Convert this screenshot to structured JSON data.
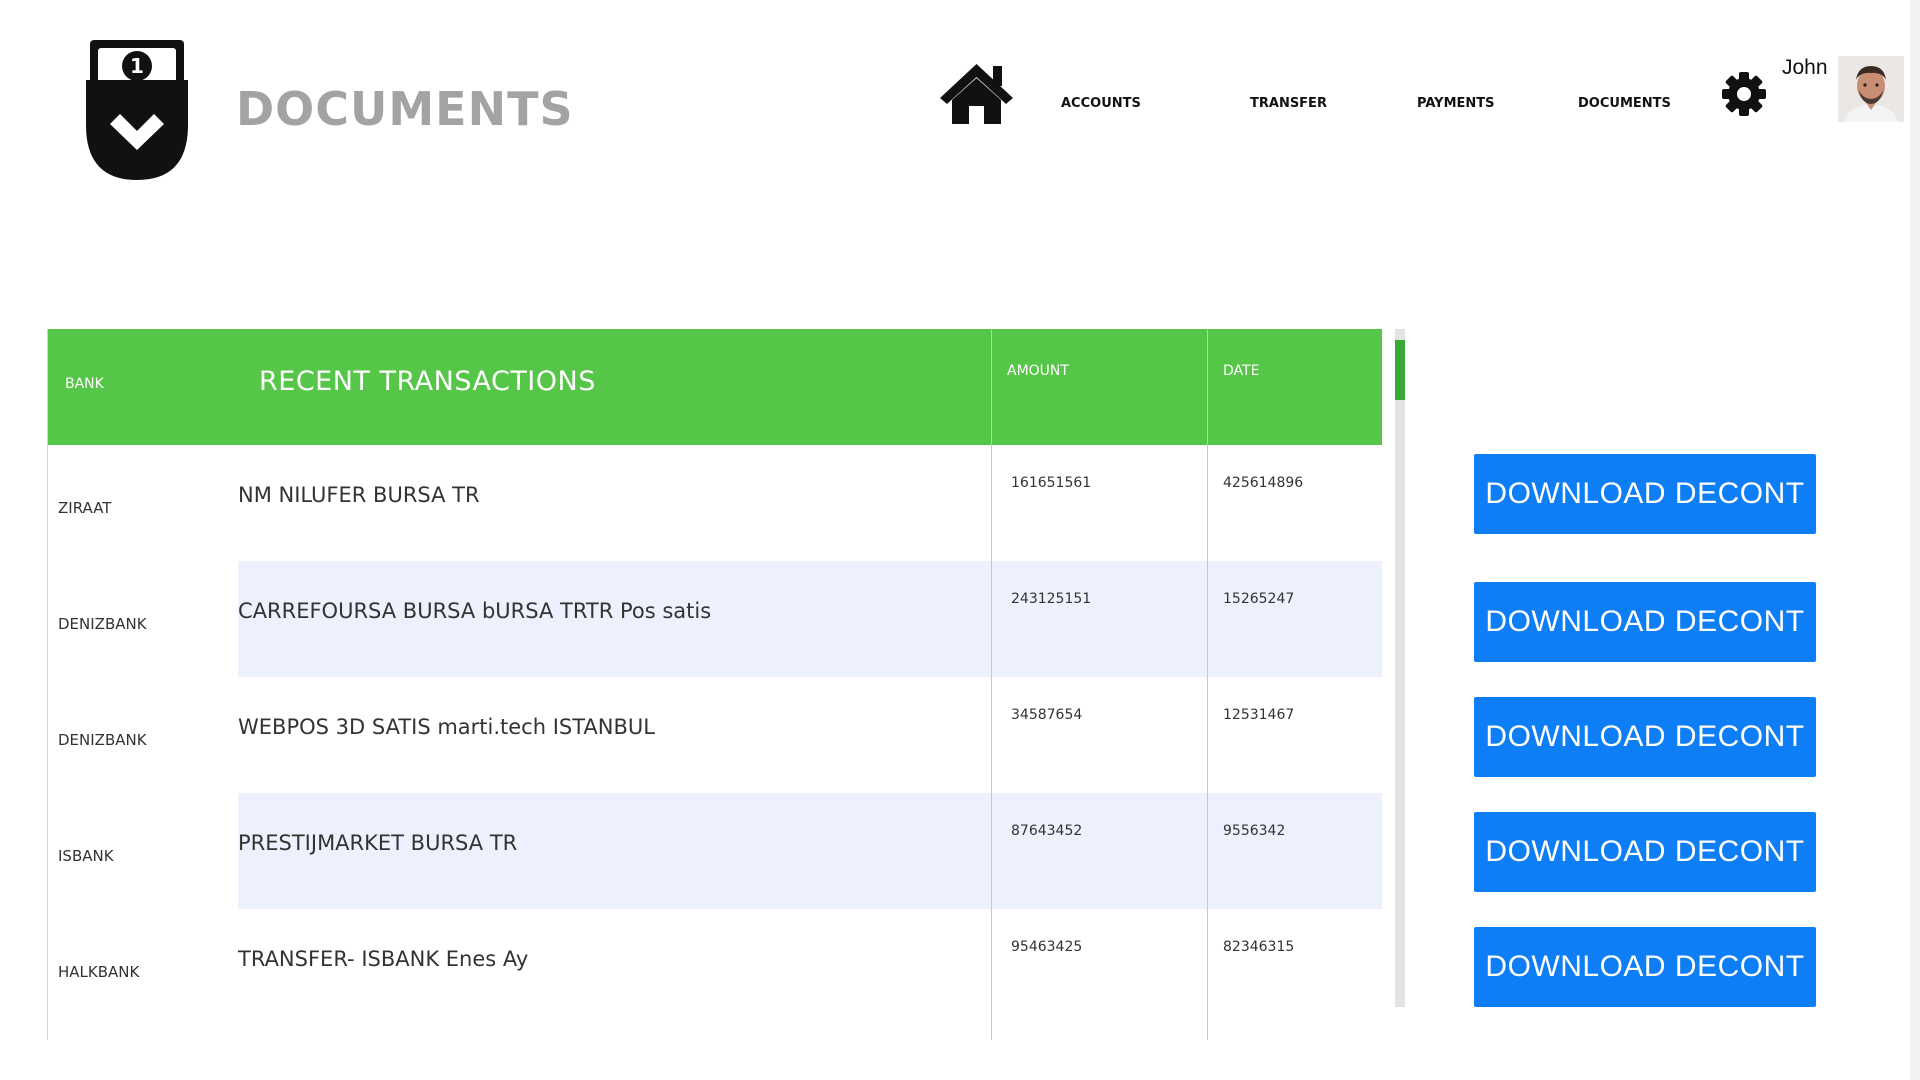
{
  "header": {
    "page_title": "DOCUMENTS",
    "logo_icon": "wallet-shield-download-icon",
    "home_icon": "home-icon",
    "settings_icon": "gear-icon",
    "user_name": "John"
  },
  "nav": {
    "items": [
      {
        "label": "ACCOUNTS"
      },
      {
        "label": "TRANSFER"
      },
      {
        "label": "PAYMENTS"
      },
      {
        "label": "DOCUMENTS"
      }
    ]
  },
  "table": {
    "headers": {
      "bank": "BANK",
      "title": "RECENT TRANSACTIONS",
      "amount": "AMOUNT",
      "date": "DATE"
    },
    "rows": [
      {
        "bank": "ZIRAAT",
        "description": "NM NILUFER BURSA TR",
        "amount": "161651561",
        "date": "425614896"
      },
      {
        "bank": "DENIZBANK",
        "description": "CARREFOURSA BURSA bURSA TRTR Pos satis",
        "amount": "243125151",
        "date": "15265247"
      },
      {
        "bank": "DENIZBANK",
        "description": "WEBPOS 3D SATIS marti.tech ISTANBUL",
        "amount": "34587654",
        "date": "12531467"
      },
      {
        "bank": "ISBANK",
        "description": "PRESTIJMARKET BURSA TR",
        "amount": "87643452",
        "date": "9556342"
      },
      {
        "bank": "HALKBANK",
        "description": "TRANSFER- ISBANK Enes Ay",
        "amount": "95463425",
        "date": "82346315"
      }
    ]
  },
  "actions": {
    "download_label": "DOWNLOAD DECONT"
  },
  "colors": {
    "header_green": "#56c648",
    "button_blue": "#0d7ef5",
    "row_shade": "#edf1fd",
    "title_gray": "#a3a3a3"
  }
}
